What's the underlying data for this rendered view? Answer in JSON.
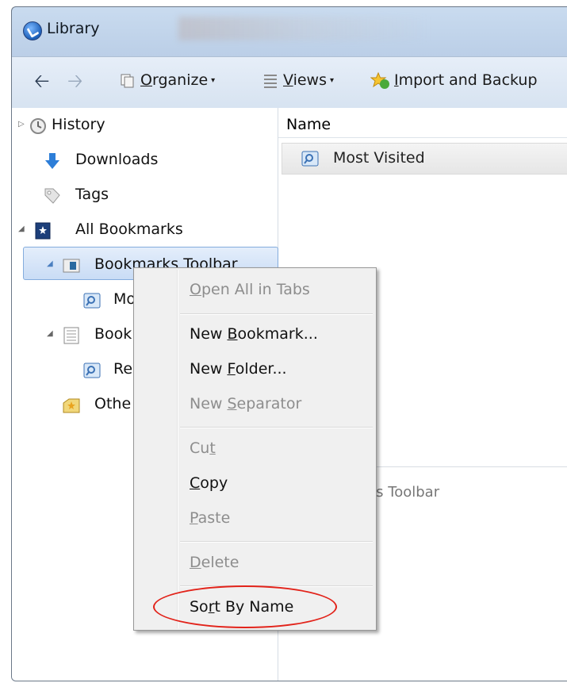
{
  "window": {
    "title": "Library"
  },
  "toolbar": {
    "organize_label": "Organize",
    "views_label": "Views",
    "import_label": "Import and Backup"
  },
  "sidebar": {
    "items": [
      {
        "label": "History",
        "icon": "history-icon"
      },
      {
        "label": "Downloads",
        "icon": "downloads-icon"
      },
      {
        "label": "Tags",
        "icon": "tag-icon"
      },
      {
        "label": "All Bookmarks",
        "icon": "bookmarks-icon"
      },
      {
        "label": "Bookmarks Toolbar",
        "icon": "toolbar-folder-icon",
        "selected": true
      },
      {
        "label": "Mo",
        "icon": "smart-folder-icon"
      },
      {
        "label": "Book",
        "icon": "menu-folder-icon"
      },
      {
        "label": "Re",
        "icon": "smart-folder-icon"
      },
      {
        "label": "Othe",
        "icon": "other-bookmarks-icon"
      }
    ]
  },
  "content": {
    "column_name": "Name",
    "rows": [
      {
        "label": "Most Visited",
        "icon": "smart-folder-icon"
      }
    ],
    "details_name": "Bookmarks Toolbar"
  },
  "context_menu": {
    "open_all": {
      "pre": "",
      "key": "O",
      "post": "pen All in Tabs",
      "enabled": false
    },
    "new_bookmark": {
      "pre": "New ",
      "key": "B",
      "post": "ookmark...",
      "enabled": true
    },
    "new_folder": {
      "pre": "New ",
      "key": "F",
      "post": "older...",
      "enabled": true
    },
    "new_separator": {
      "pre": "New ",
      "key": "S",
      "post": "eparator",
      "enabled": false
    },
    "cut": {
      "pre": "Cu",
      "key": "t",
      "post": "",
      "enabled": false
    },
    "copy": {
      "pre": "",
      "key": "C",
      "post": "opy",
      "enabled": true
    },
    "paste": {
      "pre": "",
      "key": "P",
      "post": "aste",
      "enabled": false
    },
    "delete": {
      "pre": "",
      "key": "D",
      "post": "elete",
      "enabled": false
    },
    "sort_by_name": {
      "pre": "So",
      "key": "r",
      "post": "t By Name",
      "enabled": true,
      "highlighted": true
    }
  },
  "colors": {
    "annotation": "#e2231a",
    "selection": "#c9dcf5",
    "disabled_text": "#8d8d8d"
  }
}
